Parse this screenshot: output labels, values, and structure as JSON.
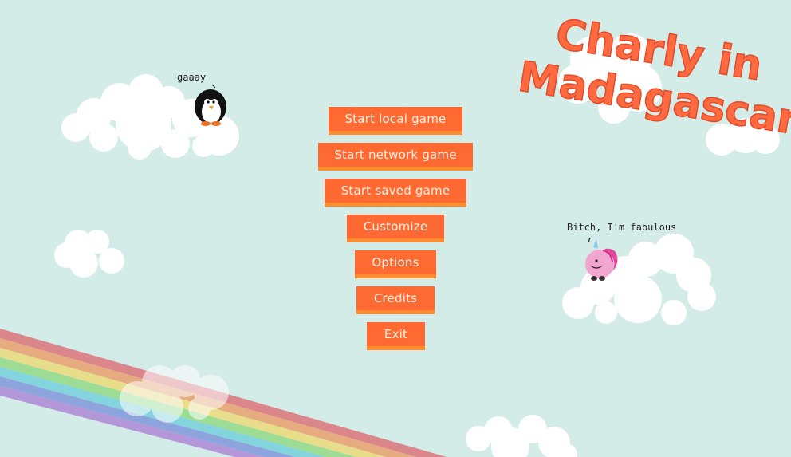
{
  "title": {
    "line1": "Charly in",
    "line2": "Madagascar"
  },
  "menu": {
    "start_local": "Start local game",
    "start_network": "Start network game",
    "start_saved": "Start saved game",
    "customize": "Customize",
    "options": "Options",
    "credits": "Credits",
    "exit": "Exit"
  },
  "characters": {
    "penguin_speech": "gaaay",
    "unicorn_speech": "Bitch, I'm fabulous"
  },
  "colors": {
    "background": "#d4ece8",
    "button": "#ff6a33",
    "button_accent": "#ff8c2e",
    "title": "#ff6a40"
  }
}
